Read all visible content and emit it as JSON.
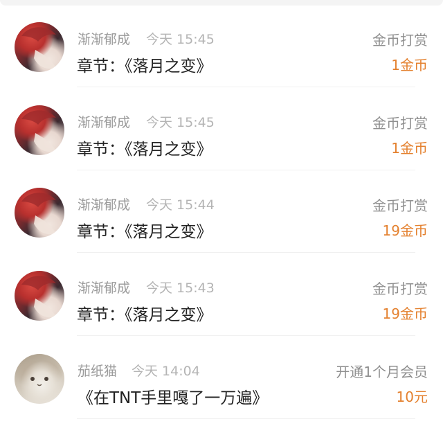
{
  "records": [
    {
      "user": "渐渐郁成",
      "time": "今天 15:45",
      "title": "章节：《落月之变》",
      "type": "金币打赏",
      "amount": "1金币",
      "avatar": "red-hair-character-avatar"
    },
    {
      "user": "渐渐郁成",
      "time": "今天 15:45",
      "title": "章节：《落月之变》",
      "type": "金币打赏",
      "amount": "1金币",
      "avatar": "red-hair-character-avatar"
    },
    {
      "user": "渐渐郁成",
      "time": "今天 15:44",
      "title": "章节：《落月之变》",
      "type": "金币打赏",
      "amount": "19金币",
      "avatar": "red-hair-character-avatar"
    },
    {
      "user": "渐渐郁成",
      "time": "今天 15:43",
      "title": "章节：《落月之变》",
      "type": "金币打赏",
      "amount": "19金币",
      "avatar": "red-hair-character-avatar"
    },
    {
      "user": "茄纸猫",
      "time": "今天 14:04",
      "title": "《在TNT手里嘎了一万遍》",
      "type": "开通1个月会员",
      "amount": "10元",
      "avatar": "cat-avatar"
    }
  ],
  "colors": {
    "amount": "#e4812f",
    "name": "#9a9a9a",
    "title": "#222222"
  }
}
